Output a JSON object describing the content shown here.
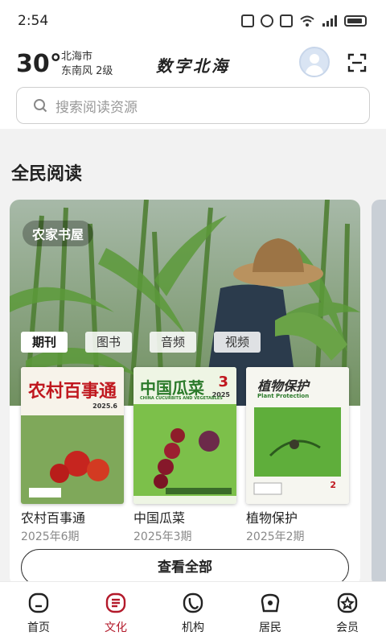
{
  "status_bar": {
    "time": "2:54"
  },
  "header": {
    "temperature": "30°",
    "city": "北海市",
    "wind": "东南风 2级",
    "brand": "数字北海"
  },
  "search": {
    "placeholder": "搜索阅读资源"
  },
  "section": {
    "title": "全民阅读"
  },
  "card": {
    "badge": "农家书屋",
    "tabs": [
      "期刊",
      "图书",
      "音频",
      "视频"
    ],
    "active_tab": "期刊",
    "magazines": [
      {
        "name": "农村百事通",
        "issue": "2025年6期",
        "cover_title": "农村百事通",
        "cover_num": "2025.6"
      },
      {
        "name": "中国瓜菜",
        "issue": "2025年3期",
        "cover_title": "中国瓜菜",
        "cover_num": "3",
        "cover_year": "2025",
        "cover_sub": "CHINA CUCURBITS AND VEGETABLES"
      },
      {
        "name": "植物保护",
        "issue": "2025年2期",
        "cover_title": "植物保护",
        "cover_num": "2",
        "cover_sub": "Plant Protection"
      }
    ],
    "view_all": "查看全部"
  },
  "bottom_nav": [
    {
      "label": "首页",
      "icon": "home-icon"
    },
    {
      "label": "文化",
      "icon": "culture-icon",
      "active": true
    },
    {
      "label": "机构",
      "icon": "institution-icon"
    },
    {
      "label": "居民",
      "icon": "resident-icon"
    },
    {
      "label": "会员",
      "icon": "member-icon"
    }
  ],
  "colors": {
    "accent": "#b3192a"
  }
}
